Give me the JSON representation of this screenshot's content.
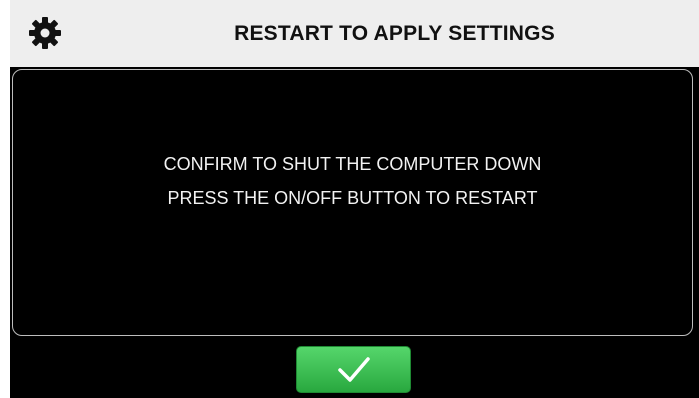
{
  "header": {
    "icon": "gear-icon",
    "title": "RESTART TO APPLY SETTINGS"
  },
  "dialog": {
    "line1": "CONFIRM TO SHUT THE COMPUTER DOWN",
    "line2": "PRESS THE ON/OFF BUTTON TO RESTART"
  },
  "confirm_button": {
    "icon": "check-icon"
  },
  "colors": {
    "header_bg": "#eeeeee",
    "screen_bg": "#000000",
    "confirm_green": "#3cc052"
  }
}
